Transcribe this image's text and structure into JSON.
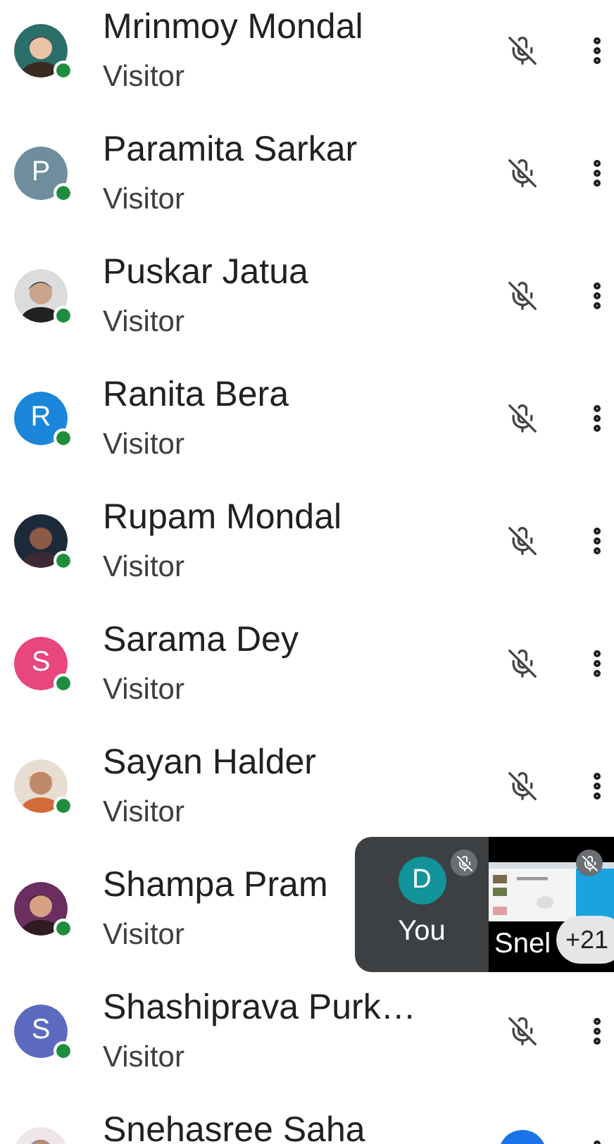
{
  "participants": [
    {
      "name": "Mrinmoy Mondal",
      "role": "Visitor",
      "online": true,
      "mic_muted": true
    },
    {
      "name": "Paramita Sarkar",
      "role": "Visitor",
      "avatar": {
        "kind": "initial",
        "initial": "P",
        "color": "#6f8d9c"
      },
      "online": true,
      "mic_muted": true
    },
    {
      "name": "Puskar Jatua",
      "role": "Visitor",
      "online": true,
      "mic_muted": true
    },
    {
      "name": "Ranita Bera",
      "role": "Visitor",
      "avatar": {
        "kind": "initial",
        "initial": "R",
        "color": "#1a86d9"
      },
      "online": true,
      "mic_muted": true
    },
    {
      "name": "Rupam Mondal",
      "role": "Visitor",
      "online": true,
      "mic_muted": true
    },
    {
      "name": "Sarama Dey",
      "role": "Visitor",
      "avatar": {
        "kind": "initial",
        "initial": "S",
        "color": "#e8467c"
      },
      "online": true,
      "mic_muted": true
    },
    {
      "name": "Sayan Halder",
      "role": "Visitor",
      "online": true,
      "mic_muted": true
    },
    {
      "name": "Shampa Pram",
      "role": "Visitor",
      "online": true
    },
    {
      "name": "Shashiprava Purk…",
      "role": "Visitor",
      "avatar": {
        "kind": "initial",
        "initial": "S",
        "color": "#5c6bc0"
      },
      "online": true,
      "mic_muted": true
    },
    {
      "name": "Snehasree Saha",
      "mic_muted": false
    }
  ],
  "self_tile": {
    "initial": "D",
    "label": "You",
    "muted": true
  },
  "screen_tile": {
    "label": "Snel",
    "muted": true,
    "more_count": "+21"
  }
}
